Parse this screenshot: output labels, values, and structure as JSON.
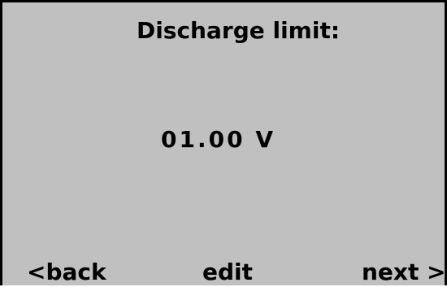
{
  "screen": {
    "title": "Discharge limit:",
    "value": "01.00 V",
    "softkeys": {
      "back_label": "<back",
      "edit_label": "edit",
      "next_label": "next >"
    }
  },
  "colors": {
    "background": "#c0c0c0",
    "text": "#000000",
    "border": "#000000"
  }
}
